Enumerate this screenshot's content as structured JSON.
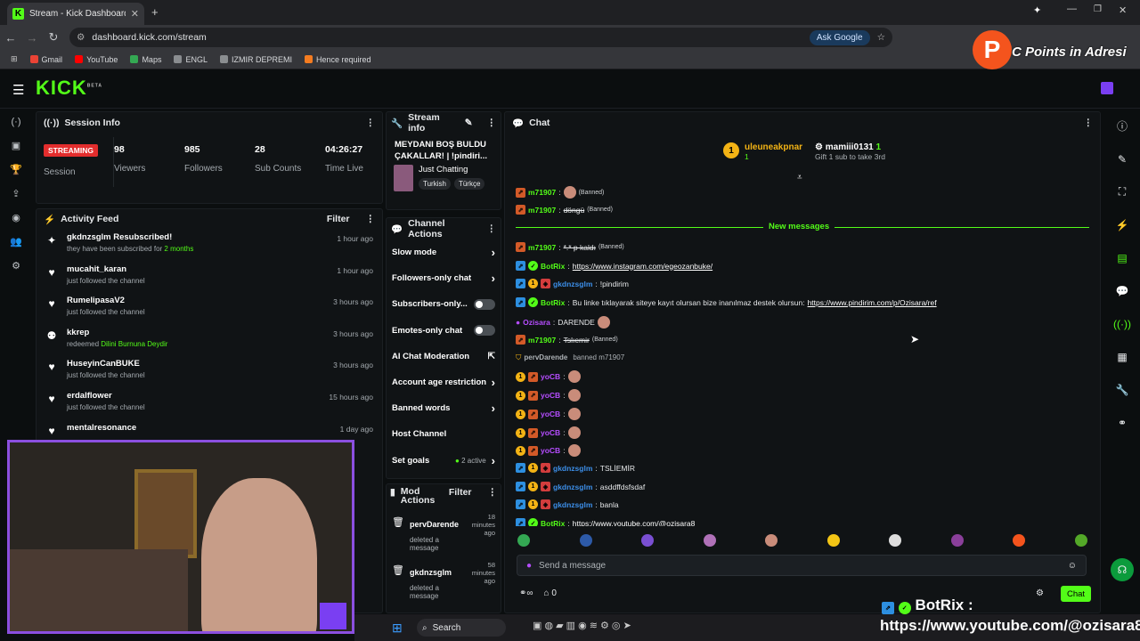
{
  "browser": {
    "tab_title": "Stream - Kick Dashboard",
    "url": "dashboard.kick.com/stream",
    "ask_google": "Ask Google",
    "bookmarks": [
      "Gmail",
      "YouTube",
      "Maps",
      "ENGL",
      "IZMIR DEPREMI",
      "Hence required"
    ]
  },
  "brand": {
    "logo": "KICK",
    "beta": "BETA",
    "accent": "#53fc18"
  },
  "session": {
    "title": "Session Info",
    "badge": "STREAMING",
    "session_label": "Session",
    "stats": [
      {
        "value": "98",
        "label": "Viewers"
      },
      {
        "value": "985",
        "label": "Followers"
      },
      {
        "value": "28",
        "label": "Sub Counts"
      },
      {
        "value": "04:26:27",
        "label": "Time Live"
      }
    ]
  },
  "activity": {
    "title": "Activity Feed",
    "filter": "Filter",
    "items": [
      {
        "icon": "star-icon",
        "name": "gkdnzsglm Resubscribed!",
        "sub": "they have been subscribed for ",
        "sub_hl": "2 months",
        "time": "1 hour ago"
      },
      {
        "icon": "heart-icon",
        "name": "mucahit_karan",
        "sub": "just followed the channel",
        "sub_hl": "",
        "time": "1 hour ago"
      },
      {
        "icon": "heart-icon",
        "name": "RumelipasaV2",
        "sub": "just followed the channel",
        "sub_hl": "",
        "time": "3 hours ago"
      },
      {
        "icon": "reward-icon",
        "name": "kkrep",
        "sub": "redeemed ",
        "sub_hl": "Dilini Burnuna Deydir",
        "time": "3 hours ago"
      },
      {
        "icon": "heart-icon",
        "name": "HuseyinCanBUKE",
        "sub": "just followed the channel",
        "sub_hl": "",
        "time": "3 hours ago"
      },
      {
        "icon": "heart-icon",
        "name": "erdalflower",
        "sub": "just followed the channel",
        "sub_hl": "",
        "time": "15 hours ago"
      },
      {
        "icon": "heart-icon",
        "name": "mentalresonance",
        "sub": "",
        "sub_hl": "",
        "time": "1 day ago"
      }
    ]
  },
  "stream_info": {
    "title": "Stream info",
    "stream_title": "MEYDANI BOŞ BULDU ÇAKALLAR! | !pindiri...",
    "category": "Just Chatting",
    "tags": [
      "Turkish",
      "Türkçe"
    ]
  },
  "channel_actions": {
    "title": "Channel Actions",
    "items": [
      {
        "label": "Slow mode",
        "control": "arrow"
      },
      {
        "label": "Followers-only chat",
        "control": "arrow"
      },
      {
        "label": "Subscribers-only...",
        "control": "toggle"
      },
      {
        "label": "Emotes-only chat",
        "control": "toggle"
      },
      {
        "label": "AI Chat Moderation",
        "control": "external"
      },
      {
        "label": "Account age restriction",
        "control": "arrow"
      },
      {
        "label": "Banned words",
        "control": "arrow"
      },
      {
        "label": "Host Channel",
        "control": "none"
      },
      {
        "label": "Set goals",
        "control": "goals",
        "extra": "2 active"
      }
    ]
  },
  "mod_actions": {
    "title": "Mod Actions",
    "filter": "Filter",
    "items": [
      {
        "user": "pervDarende",
        "action": "deleted a message",
        "time": "18 minutes ago"
      },
      {
        "user": "gkdnzsglm",
        "action": "deleted a message",
        "time": "58 minutes ago"
      }
    ]
  },
  "chat": {
    "title": "Chat",
    "new_messages": "New messages",
    "placeholder": "Send a message",
    "send": "Chat",
    "points": "0",
    "top_gifters": [
      {
        "name": "uleuneakpnar",
        "count": "1",
        "note": ""
      },
      {
        "name": "mamiii0131",
        "count": "1",
        "note": "Gift 1 sub to take 3rd"
      }
    ],
    "messages": [
      {
        "badges": [
          "ban"
        ],
        "user": "m71907",
        "color": "#53fc18",
        "text": "",
        "emote": true,
        "banned": "(Banned)"
      },
      {
        "badges": [
          "ban"
        ],
        "user": "m71907",
        "color": "#53fc18",
        "text": "döngü",
        "strike": true,
        "banned": "(Banned)"
      },
      {
        "badges": [
          "ban"
        ],
        "user": "m71907",
        "color": "#53fc18",
        "text": "*.* p kaldı",
        "strike": true,
        "banned": "(Banned)"
      },
      {
        "badges": [
          "mod",
          "ver"
        ],
        "user": "BotRix",
        "color": "#53fc18",
        "text": "https://www.instagram.com/egeozanbuke/",
        "link": true
      },
      {
        "badges": [
          "mod",
          "sub",
          "red"
        ],
        "user": "gkdnzsglm",
        "color": "#3c8ee8",
        "text": "!pindirim"
      },
      {
        "badges": [
          "mod",
          "ver"
        ],
        "user": "BotRix",
        "color": "#53fc18",
        "text": "Bu linke tıklayarak siteye kayıt olursan bize inanılmaz destek olursun: ",
        "link_text": "https://www.pindirim.com/p/Ozisara/ref"
      },
      {
        "badges": [
          "mic"
        ],
        "user": "Ozisara",
        "color": "#b64dff",
        "text": "DARENDE",
        "emote": true
      },
      {
        "badges": [
          "ban"
        ],
        "user": "m71907",
        "color": "#53fc18",
        "text": "Tslıemir",
        "strike": true,
        "banned": "(Banned)"
      },
      {
        "badges": [
          "shield"
        ],
        "user": "pervDarende",
        "color": "#aeb3b7",
        "text": "banned m71907",
        "system": true
      },
      {
        "badges": [
          "sub",
          "ban"
        ],
        "user": "yoCB",
        "color": "#b64dff",
        "text": "",
        "emote": true
      },
      {
        "badges": [
          "sub",
          "ban"
        ],
        "user": "yoCB",
        "color": "#b64dff",
        "text": "",
        "emote": true
      },
      {
        "badges": [
          "sub",
          "ban"
        ],
        "user": "yoCB",
        "color": "#b64dff",
        "text": "",
        "emote": true
      },
      {
        "badges": [
          "sub",
          "ban"
        ],
        "user": "yoCB",
        "color": "#b64dff",
        "text": "",
        "emote": true
      },
      {
        "badges": [
          "sub",
          "ban"
        ],
        "user": "yoCB",
        "color": "#b64dff",
        "text": "",
        "emote": true
      },
      {
        "badges": [
          "mod",
          "sub",
          "red"
        ],
        "user": "gkdnzsglm",
        "color": "#3c8ee8",
        "text": "TSLİEMİR"
      },
      {
        "badges": [
          "mod",
          "sub",
          "red"
        ],
        "user": "gkdnzsglm",
        "color": "#3c8ee8",
        "text": "asddffdsfsdaf"
      },
      {
        "badges": [
          "mod",
          "sub",
          "red"
        ],
        "user": "gkdnzsglm",
        "color": "#3c8ee8",
        "text": "banla"
      },
      {
        "badges": [
          "mod",
          "ver"
        ],
        "user": "BotRix",
        "color": "#53fc18",
        "text": "https://www.youtube.com/@ozisara8",
        "link": true
      }
    ]
  },
  "overlay": {
    "points_text": "C Points in Adresi",
    "p_logo": "P",
    "botrix_label": "BotRix :",
    "botrix_link": "https://www.youtube.com/@ozisara8"
  },
  "taskbar": {
    "search": "Search"
  }
}
